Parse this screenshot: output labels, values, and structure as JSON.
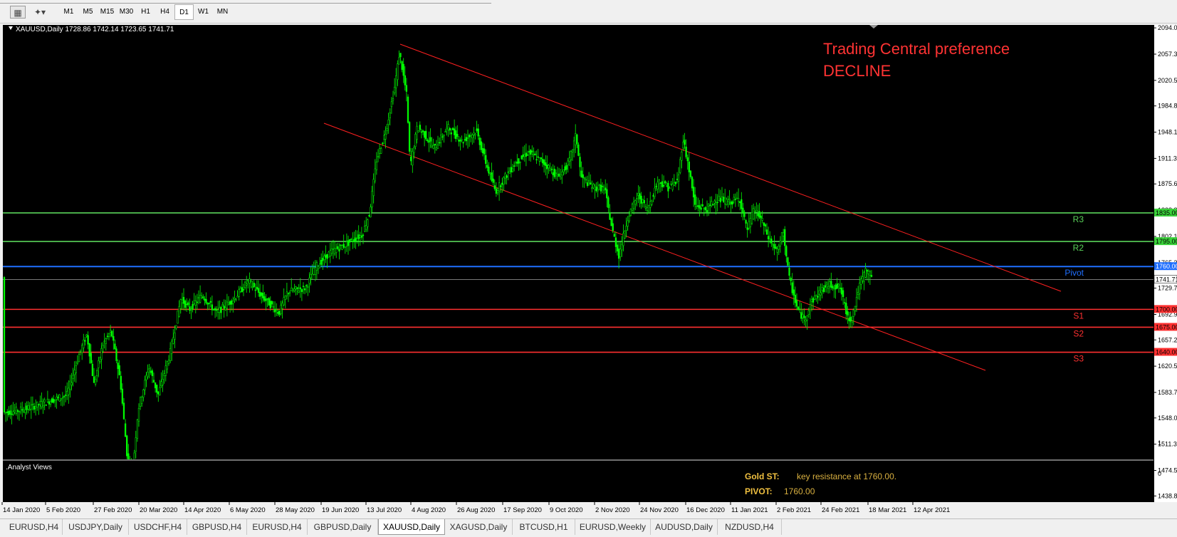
{
  "toolbar": {
    "timeframes": [
      {
        "label": "M1"
      },
      {
        "label": "M5"
      },
      {
        "label": "M15"
      },
      {
        "label": "M30"
      },
      {
        "label": "H1"
      },
      {
        "label": "H4"
      },
      {
        "label": "D1",
        "active": true
      },
      {
        "label": "W1"
      },
      {
        "label": "MN"
      }
    ]
  },
  "chart": {
    "header": "XAUUSD,Daily  1728.86 1742.14 1723.65 1741.71",
    "preference_title": "Trading Central preference",
    "preference_value": "DECLINE",
    "colors": {
      "candle": "#00ff00",
      "channel": "#ff2020",
      "resistance": "#5ad25a",
      "pivot": "#1f6fff",
      "support": "#ff3030",
      "current": "#c0c0c0",
      "preference": "#ff3333"
    },
    "levels": [
      {
        "label": "R3",
        "price": "1835.00",
        "value": 1835,
        "kind": "resistance"
      },
      {
        "label": "R2",
        "price": "1795.00",
        "value": 1795,
        "kind": "resistance"
      },
      {
        "label": "Pivot",
        "price": "1760.00",
        "value": 1760,
        "kind": "pivot"
      },
      {
        "label": "S1",
        "price": "1700.00",
        "value": 1700,
        "kind": "support"
      },
      {
        "label": "S2",
        "price": "1675.00",
        "value": 1675,
        "kind": "support"
      },
      {
        "label": "S3",
        "price": "1640.00",
        "value": 1640,
        "kind": "support"
      }
    ],
    "current_price": {
      "price": "1741.71",
      "value": 1741.71
    },
    "price_ticks": [
      "2094.05",
      "2057.30",
      "2020.55",
      "1984.80",
      "1948.10",
      "1911.35",
      "1875.60",
      "1838.85",
      "1802.10",
      "1765.35",
      "1729.75",
      "1692.90",
      "1657.25",
      "1620.50",
      "1583.75",
      "1548.00",
      "1511.30",
      "1474.55",
      "1438.80"
    ],
    "date_ticks": [
      "14 Jan 2020",
      "5 Feb 2020",
      "27 Feb 2020",
      "20 Mar 2020",
      "14 Apr 2020",
      "6 May 2020",
      "28 May 2020",
      "19 Jun 2020",
      "13 Jul 2020",
      "4 Aug 2020",
      "26 Aug 2020",
      "17 Sep 2020",
      "9 Oct 2020",
      "2 Nov 2020",
      "24 Nov 2020",
      "16 Dec 2020",
      "11 Jan 2021",
      "2 Feb 2021",
      "24 Feb 2021",
      "18 Mar 2021",
      "12 Apr 2021"
    ]
  },
  "analyst": {
    "title": ".Analyst Views",
    "gold_label": "Gold ST:",
    "gold_text": "key resistance at 1760.00.",
    "pivot_label": "PIVOT:",
    "pivot_text": "1760.00",
    "scale_top": "1",
    "scale_bottom": "0"
  },
  "tabs": [
    {
      "label": "EURUSD,H4"
    },
    {
      "label": "USDJPY,Daily"
    },
    {
      "label": "USDCHF,H4"
    },
    {
      "label": "GBPUSD,H4"
    },
    {
      "label": "EURUSD,H4"
    },
    {
      "label": "GBPUSD,Daily"
    },
    {
      "label": "XAUUSD,Daily",
      "active": true
    },
    {
      "label": "XAGUSD,Daily"
    },
    {
      "label": "BTCUSD,H1"
    },
    {
      "label": "EURUSD,Weekly"
    },
    {
      "label": "AUDUSD,Daily"
    },
    {
      "label": "NZDUSD,H4"
    }
  ]
}
